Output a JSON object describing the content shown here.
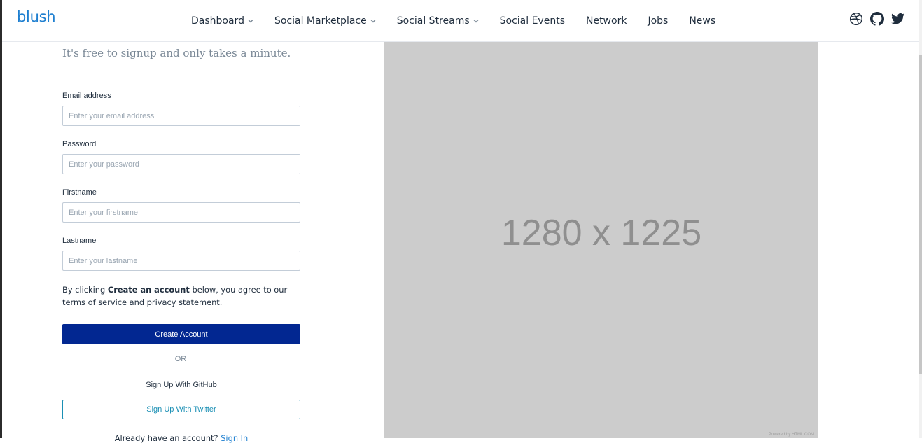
{
  "header": {
    "brand": "blush",
    "nav": [
      {
        "label": "Dashboard",
        "has_dropdown": true
      },
      {
        "label": "Social Marketplace",
        "has_dropdown": true
      },
      {
        "label": "Social Streams",
        "has_dropdown": true
      },
      {
        "label": "Social Events",
        "has_dropdown": false
      },
      {
        "label": "Network",
        "has_dropdown": false
      },
      {
        "label": "Jobs",
        "has_dropdown": false
      },
      {
        "label": "News",
        "has_dropdown": false
      }
    ],
    "social_icons": [
      "dribbble-icon",
      "github-icon",
      "twitter-icon"
    ]
  },
  "signup": {
    "tagline": "It's free to signup and only takes a minute.",
    "fields": {
      "email": {
        "label": "Email address",
        "placeholder": "Enter your email address",
        "value": ""
      },
      "password": {
        "label": "Password",
        "placeholder": "Enter your password",
        "value": ""
      },
      "firstname": {
        "label": "Firstname",
        "placeholder": "Enter your firstname",
        "value": ""
      },
      "lastname": {
        "label": "Lastname",
        "placeholder": "Enter your lastname",
        "value": ""
      }
    },
    "terms": {
      "prefix": "By clicking ",
      "bold": "Create an account",
      "suffix": " below, you agree to our terms of service and privacy statement."
    },
    "create_button": "Create Account",
    "or_text": "OR",
    "github_button": "Sign Up With GitHub",
    "twitter_button": "Sign Up With Twitter",
    "signin_prompt": "Already have an account?",
    "signin_link": "Sign In"
  },
  "image_placeholder": {
    "text": "1280 x 1225",
    "credit": "Powered by HTML.COM"
  },
  "colors": {
    "brand": "#1e7fd0",
    "primary_button": "#022791",
    "twitter_outline": "#1a8fb4",
    "placeholder_bg": "#cccccc"
  }
}
